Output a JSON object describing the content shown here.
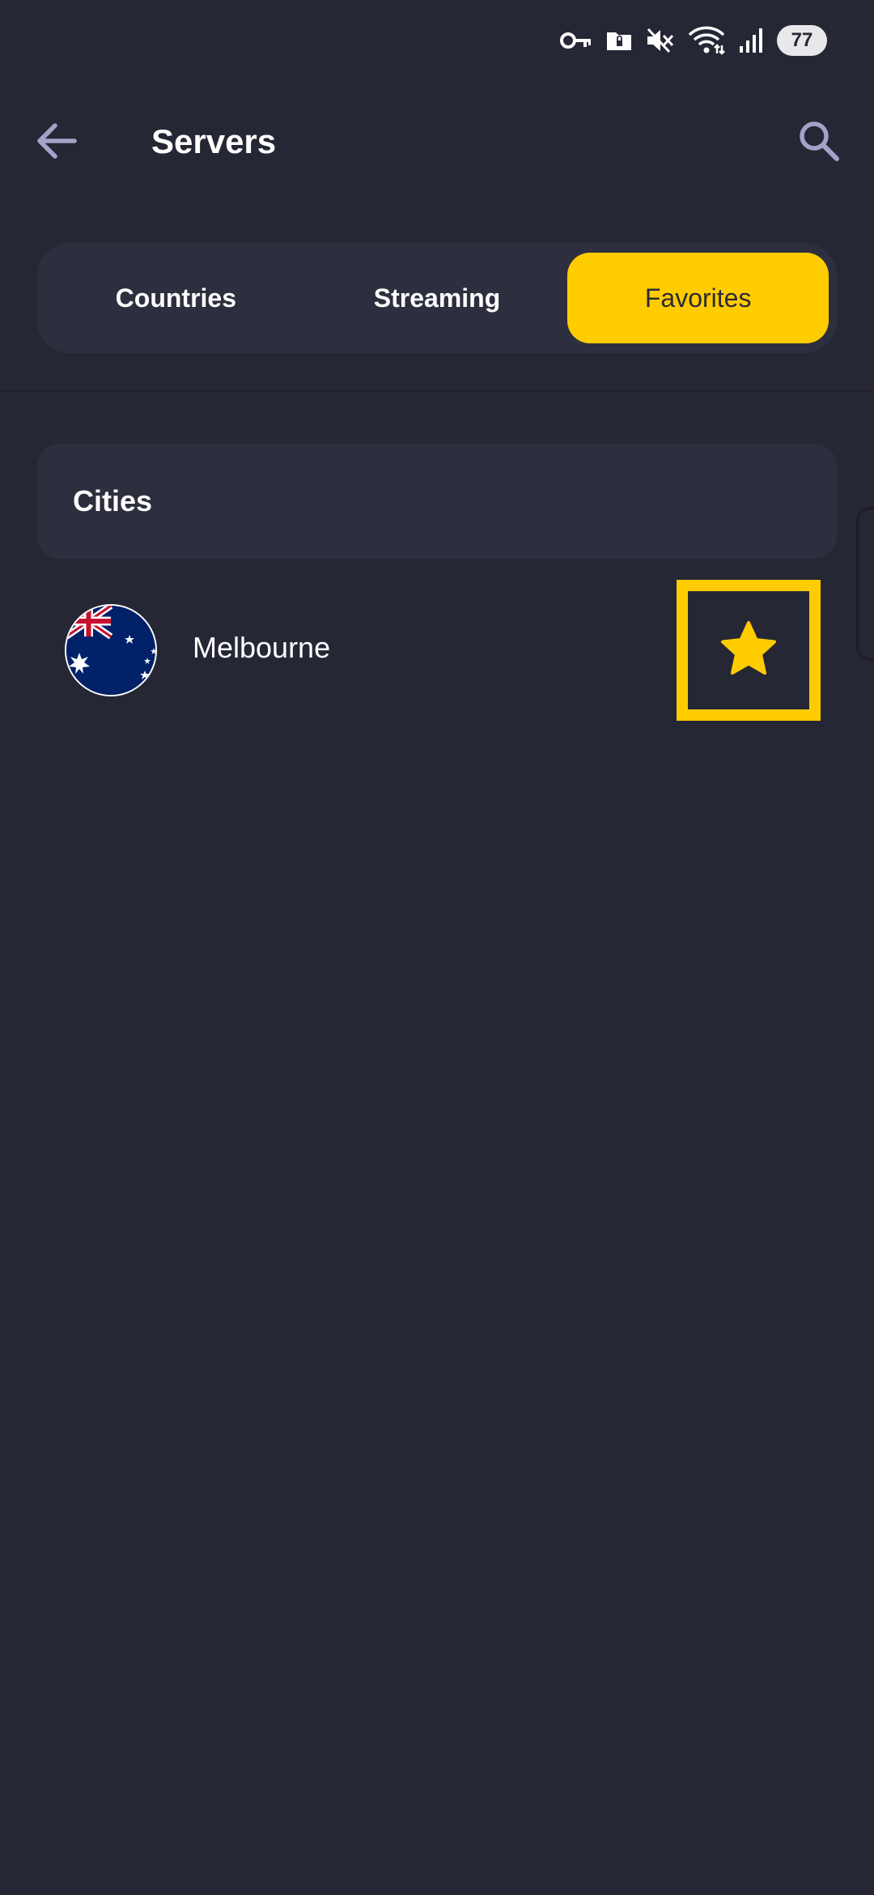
{
  "status_bar": {
    "battery": "77",
    "icons": [
      "key-icon",
      "folder-lock-icon",
      "mute-icon",
      "wifi-icon",
      "signal-icon"
    ]
  },
  "header": {
    "title": "Servers",
    "back_icon": "arrow-left-icon",
    "search_icon": "search-icon"
  },
  "tabs": [
    {
      "label": "Countries",
      "active": false
    },
    {
      "label": "Streaming",
      "active": false
    },
    {
      "label": "Favorites",
      "active": true
    }
  ],
  "section": {
    "title": "Cities"
  },
  "favorites": [
    {
      "name": "Melbourne",
      "flag": "australia-flag-icon",
      "favorite": true
    }
  ],
  "colors": {
    "background": "#262735",
    "card": "#2e2f3e",
    "accent": "#ffcc00",
    "icon_muted": "#a3a3c9"
  }
}
